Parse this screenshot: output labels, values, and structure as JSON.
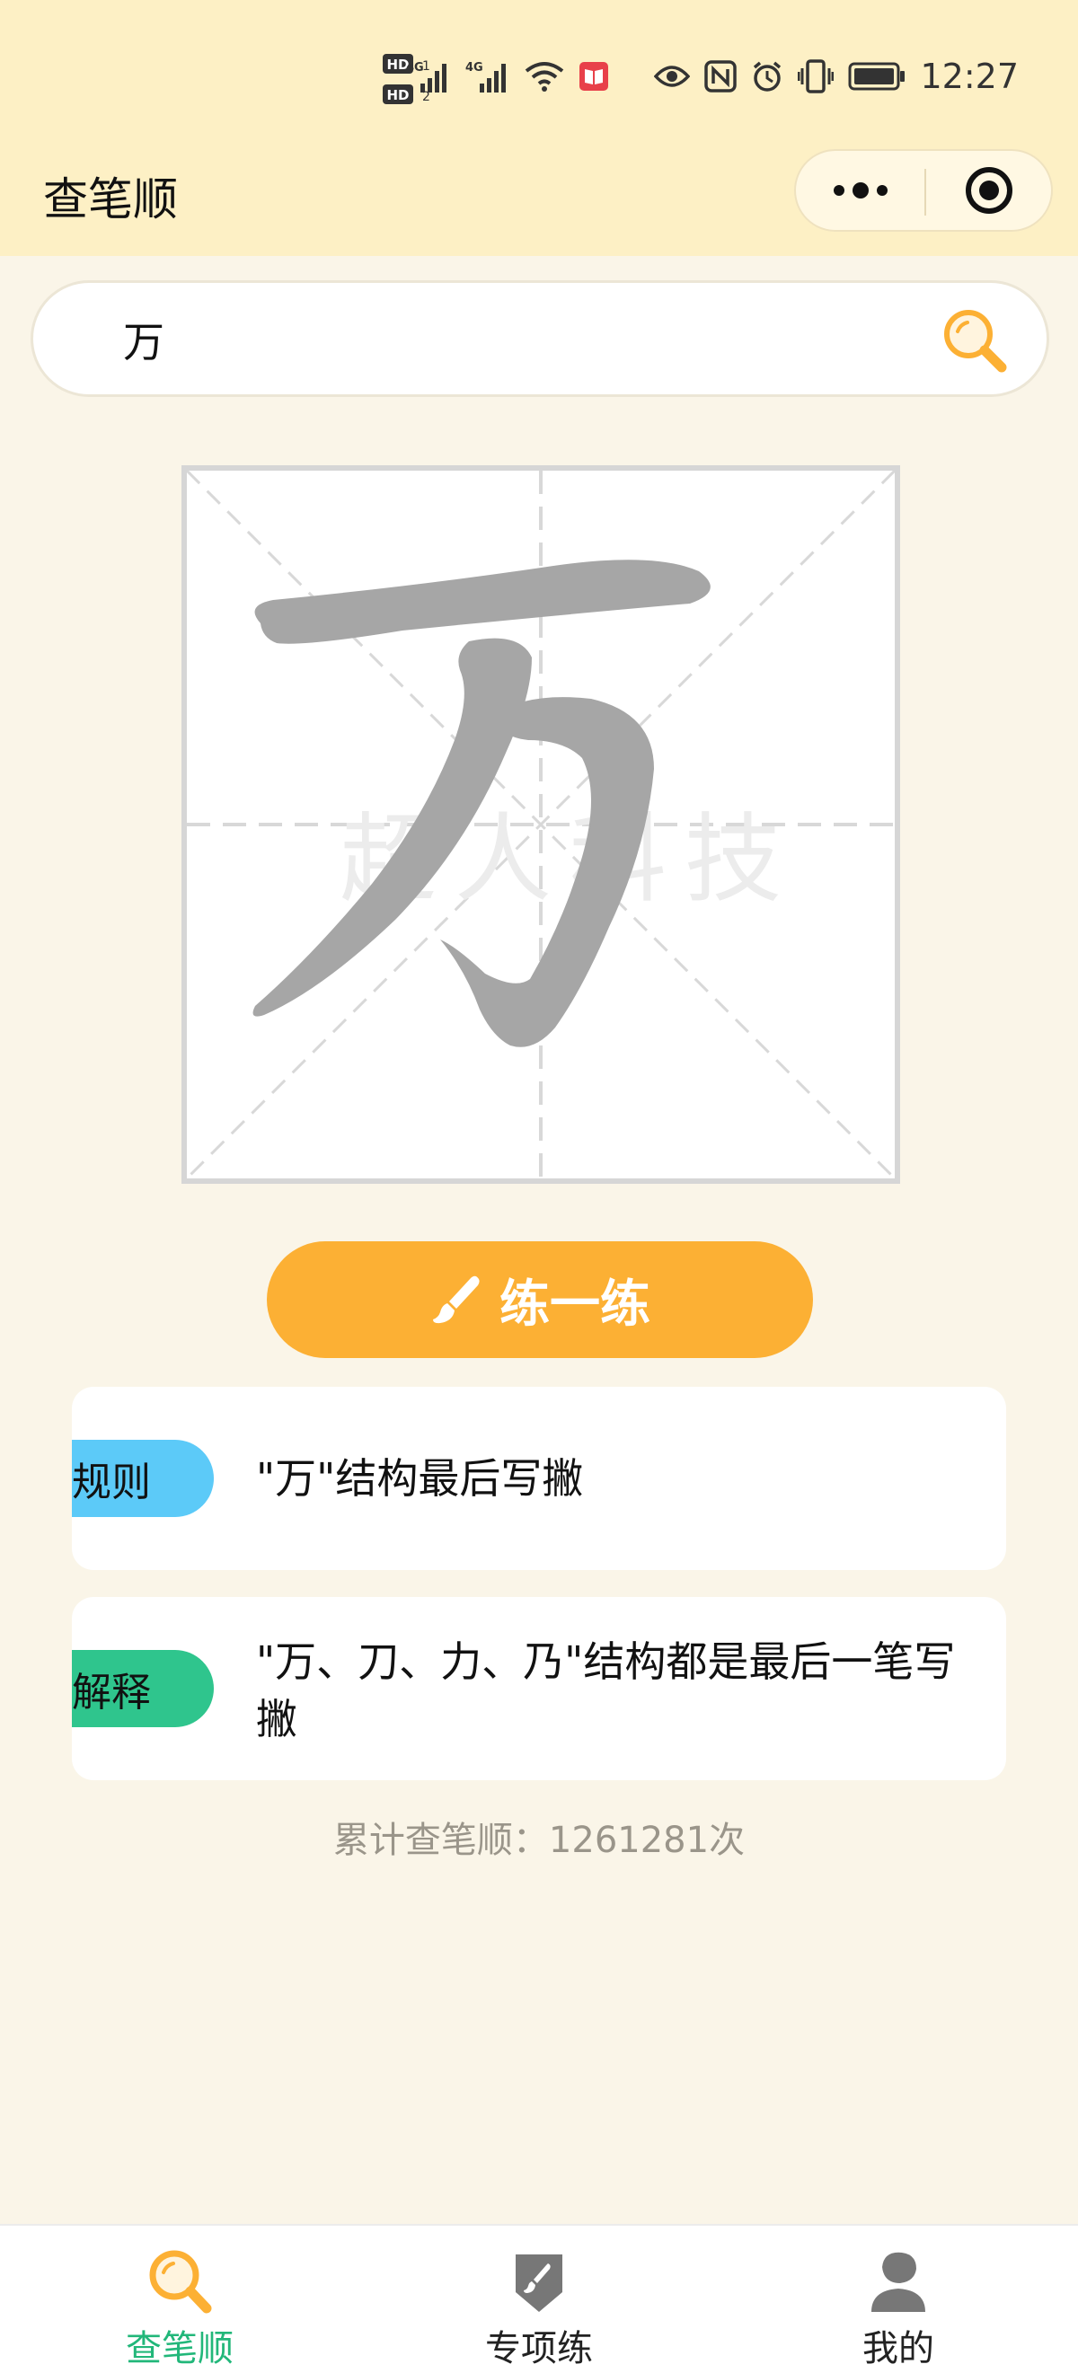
{
  "status_bar": {
    "time": "12:27",
    "hd1": "HD",
    "hd2": "HD",
    "signal1_label": "4G",
    "signal2_label": "4G",
    "icons": [
      "hd-icon",
      "signal-icon",
      "signal-icon",
      "wifi-icon",
      "book-icon",
      "eye-icon",
      "nfc-icon",
      "alarm-icon",
      "vibrate-icon",
      "battery-icon"
    ]
  },
  "nav": {
    "title": "查笔顺"
  },
  "search": {
    "value": "万",
    "icon": "search-icon"
  },
  "character_card": {
    "character": "万",
    "watermark": "超人科技"
  },
  "practice_button": {
    "label": "练一练",
    "icon": "brush-icon"
  },
  "rule_card": {
    "tag": "规则",
    "text": "\"万\"结构最后写撇",
    "tag_color": "#5ccaf8"
  },
  "explain_card": {
    "tag": "解释",
    "text": "\"万、刀、力、乃\"结构都是最后一笔写撇",
    "tag_color": "#2fc58d"
  },
  "counter": {
    "text": "累计查笔顺：1261281次"
  },
  "tabbar": {
    "tabs": [
      {
        "label": "查笔顺",
        "icon": "search-icon",
        "active": true
      },
      {
        "label": "专项练",
        "icon": "brush-tag-icon",
        "active": false
      },
      {
        "label": "我的",
        "icon": "user-icon",
        "active": false
      }
    ]
  },
  "colors": {
    "accent": "#fcb034",
    "active_tab": "#22b77a",
    "header_bg": "#fdf0c5",
    "page_bg": "#faf5e8"
  }
}
